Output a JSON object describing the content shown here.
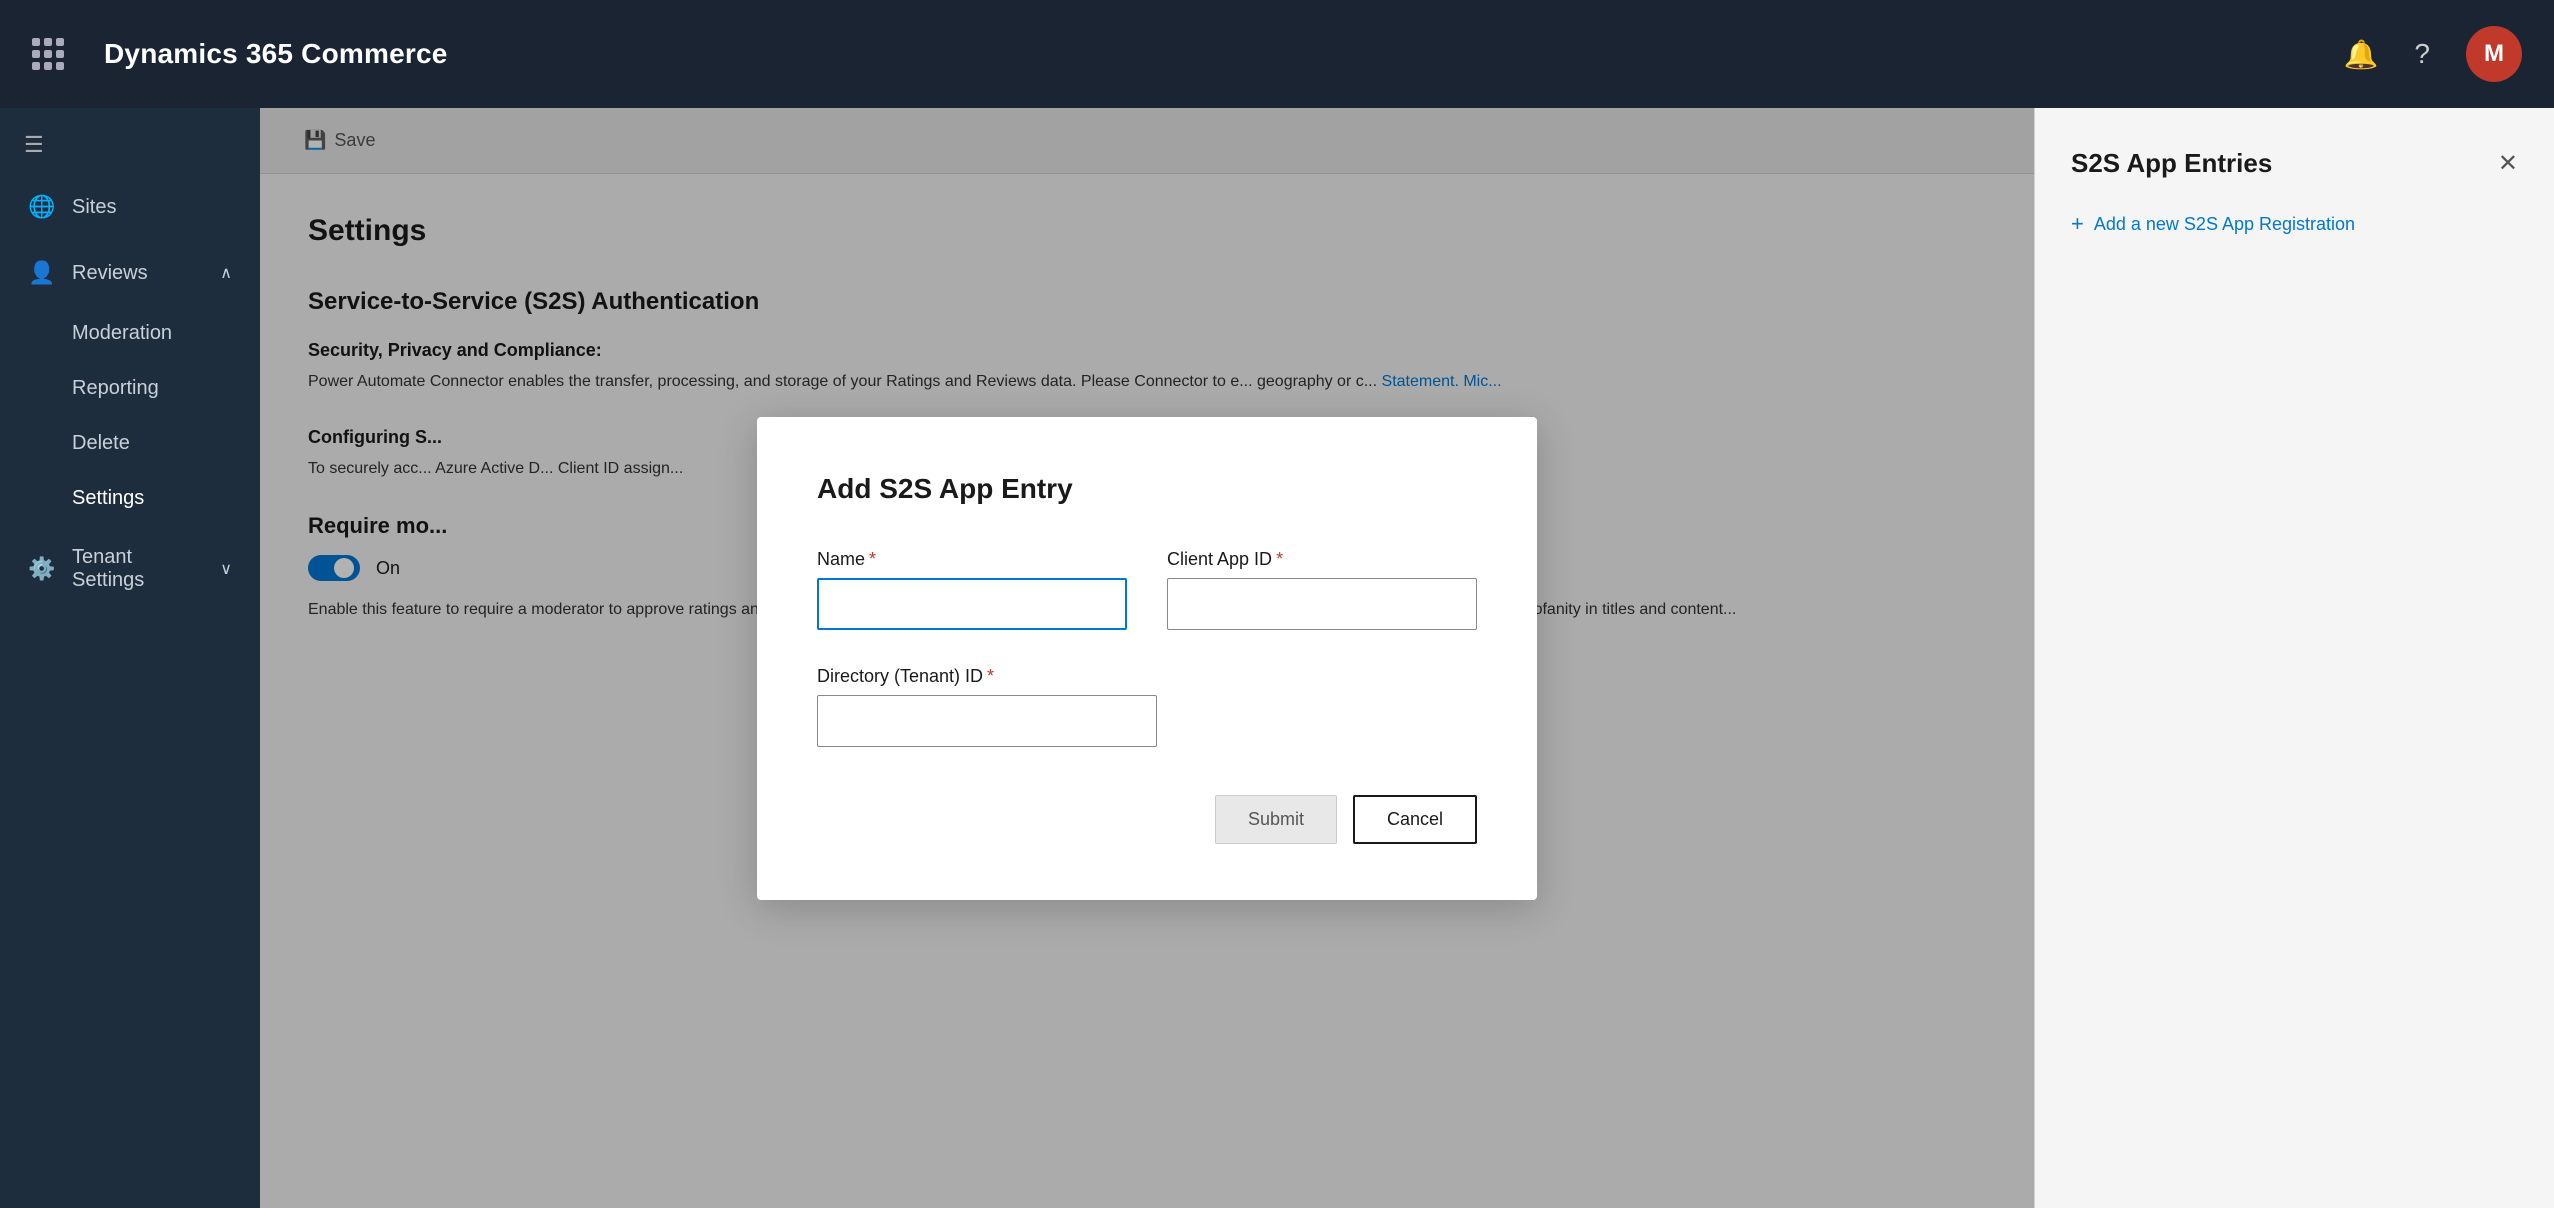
{
  "app": {
    "title": "Dynamics 365 Commerce"
  },
  "topNav": {
    "avatarLabel": "M",
    "notificationIcon": "🔔",
    "helpIcon": "?"
  },
  "sidebar": {
    "hamburgerIcon": "☰",
    "items": [
      {
        "id": "sites",
        "label": "Sites",
        "icon": "🌐",
        "active": false
      },
      {
        "id": "reviews",
        "label": "Reviews",
        "icon": "👤",
        "active": false,
        "expanded": true
      },
      {
        "id": "moderation",
        "label": "Moderation",
        "sub": true,
        "active": false
      },
      {
        "id": "reporting",
        "label": "Reporting",
        "sub": true,
        "active": false
      },
      {
        "id": "delete",
        "label": "Delete",
        "sub": true,
        "active": false
      },
      {
        "id": "settings",
        "label": "Settings",
        "sub": true,
        "active": true
      },
      {
        "id": "tenant-settings",
        "label": "Tenant Settings",
        "icon": "⚙️",
        "active": false,
        "expandable": true
      }
    ]
  },
  "toolbar": {
    "saveLabel": "Save",
    "saveIcon": "💾"
  },
  "page": {
    "title": "Settings",
    "sectionTitle": "Service-to-Service (S2S) Authentication",
    "descriptionLabel": "Security, Privacy and Compliance:",
    "descriptionText": "Power Automate Connector enables the transfer, processing, and storage of your Ratings and Reviews data. Please Connector to e... geography or c... Statement. Mic...",
    "configuringTitle": "Configuring S...",
    "configuringText": "To securely acc... Azure Active D... Client ID assign...",
    "requireModTitle": "Require mo...",
    "toggleLabel": "On",
    "enableDescText": "Enable this feature to require a moderator to approve ratings and reviews before publishing. Enabling this feature publishing. Azure Cognitive Services will continue to filter profanity in titles and content..."
  },
  "rightPanel": {
    "title": "S2S App Entries",
    "addLabel": "Add a new S2S App Registration",
    "addIcon": "+",
    "closeIcon": "✕"
  },
  "dialog": {
    "title": "Add S2S App Entry",
    "nameLabel": "Name",
    "namePlaceholder": "",
    "clientAppIdLabel": "Client App ID",
    "clientAppIdPlaceholder": "",
    "directoryTenantIdLabel": "Directory (Tenant) ID",
    "directoryTenantIdPlaceholder": "",
    "submitLabel": "Submit",
    "cancelLabel": "Cancel",
    "requiredMark": "*"
  }
}
